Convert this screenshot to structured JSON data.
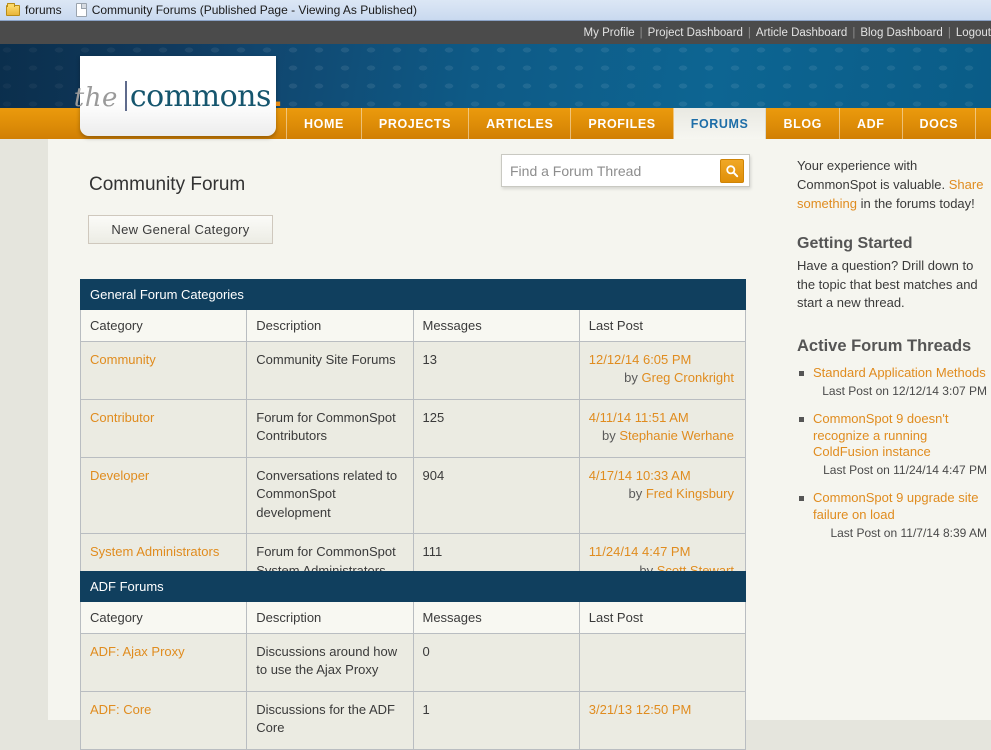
{
  "browser": {
    "tabs": [
      {
        "icon": "folder-icon",
        "label": "forums"
      },
      {
        "icon": "page-icon",
        "label": "Community Forums (Published Page - Viewing As Published)"
      }
    ]
  },
  "utility_nav": {
    "items": [
      "My Profile",
      "Project Dashboard",
      "Article Dashboard",
      "Blog Dashboard",
      "Logout"
    ],
    "separator": "|",
    "background": "#4b4b4b"
  },
  "logo": {
    "the": "the",
    "commons": "commons",
    "dot": ".",
    "accent": "#e58a14",
    "commons_color": "#16566e"
  },
  "mainnav": {
    "active": "FORUMS",
    "accent": "#e08f08",
    "items": [
      {
        "label": "HOME",
        "active": false
      },
      {
        "label": "PROJECTS",
        "active": false
      },
      {
        "label": "ARTICLES",
        "active": false
      },
      {
        "label": "PROFILES",
        "active": false
      },
      {
        "label": "FORUMS",
        "active": true
      },
      {
        "label": "BLOG",
        "active": false
      },
      {
        "label": "ADF",
        "active": false
      },
      {
        "label": "DOCS",
        "active": false
      }
    ]
  },
  "page": {
    "title": "Community Forum",
    "new_category_button": "New General Category"
  },
  "search": {
    "placeholder": "Find a Forum Thread",
    "value": "",
    "icon": "search-icon"
  },
  "tables": [
    {
      "caption": "General Forum Categories",
      "columns": [
        "Category",
        "Description",
        "Messages",
        "Last Post"
      ],
      "rows": [
        {
          "category": "Community",
          "description": "Community Site Forums",
          "messages": "13",
          "last_post_date": "12/12/14 6:05 PM",
          "last_post_by_prefix": "by ",
          "last_post_by": "Greg Cronkright"
        },
        {
          "category": "Contributor",
          "description": "Forum for CommonSpot Contributors",
          "messages": "125",
          "last_post_date": "4/11/14 11:51 AM",
          "last_post_by_prefix": "by ",
          "last_post_by": "Stephanie Werhane"
        },
        {
          "category": "Developer",
          "description": "Conversations related to CommonSpot development",
          "messages": "904",
          "last_post_date": "4/17/14 10:33 AM",
          "last_post_by_prefix": "by ",
          "last_post_by": "Fred Kingsbury"
        },
        {
          "category": "System Administrators",
          "description": "Forum for CommonSpot System Administrators",
          "messages": "111",
          "last_post_date": "11/24/14 4:47 PM",
          "last_post_by_prefix": "by ",
          "last_post_by": "Scott Stewart"
        }
      ]
    },
    {
      "caption": "ADF Forums",
      "columns": [
        "Category",
        "Description",
        "Messages",
        "Last Post"
      ],
      "rows": [
        {
          "category": "ADF: Ajax Proxy",
          "description": "Discussions around how to use the Ajax Proxy",
          "messages": "0",
          "last_post_date": "",
          "last_post_by_prefix": "",
          "last_post_by": ""
        },
        {
          "category": "ADF: Core",
          "description": "Discussions for the ADF Core",
          "messages": "1",
          "last_post_date": "3/21/13 12:50 PM",
          "last_post_by_prefix": "",
          "last_post_by": ""
        }
      ]
    }
  ],
  "sidebar": {
    "intro_part1": "Your experience with CommonSpot is valuable.  ",
    "intro_link": "Share something",
    "intro_part2": " in the forums today!",
    "getting_started_heading": "Getting Started",
    "getting_started_body": "Have a question?  Drill down to the topic that best matches and start a new thread.",
    "threads_heading": "Active Forum Threads",
    "threads": [
      {
        "title": "Standard Application Methods",
        "last_post": "Last Post on 12/12/14 3:07 PM"
      },
      {
        "title": "CommonSpot 9 doesn't recognize a running ColdFusion instance",
        "last_post": "Last Post on 11/24/14 4:47 PM"
      },
      {
        "title": "CommonSpot 9 upgrade site failure on load",
        "last_post": "Last Post on 11/7/14 8:39 AM"
      }
    ]
  }
}
